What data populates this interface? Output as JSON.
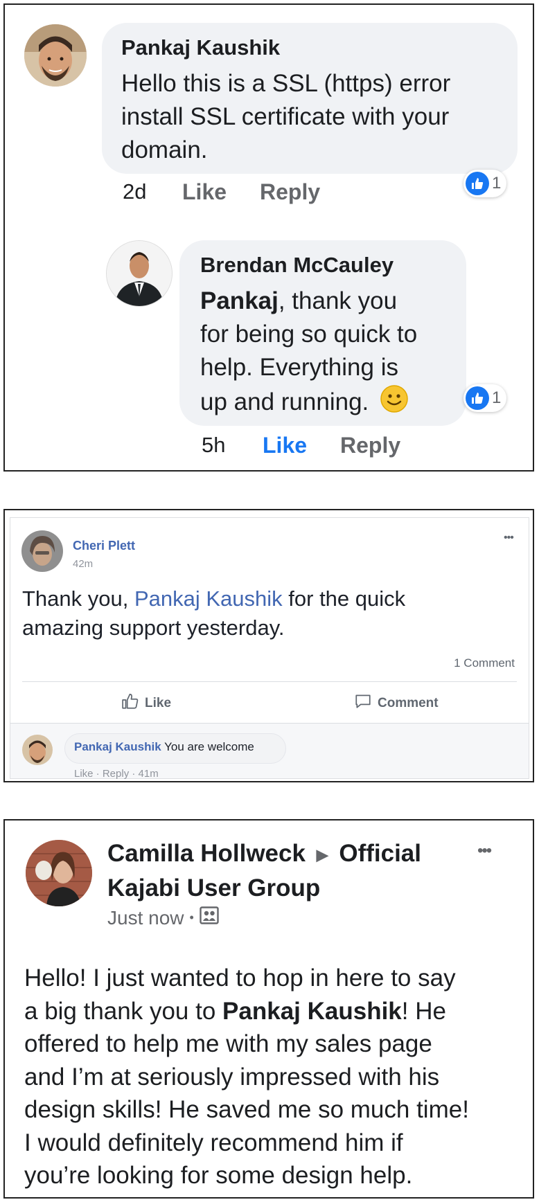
{
  "card1": {
    "comment": {
      "author": "Pankaj Kaushik",
      "lines": [
        "Hello this is a SSL (https) error",
        "install SSL certificate with your",
        "domain."
      ],
      "time": "2d",
      "like_label": "Like",
      "reply_label": "Reply",
      "reaction_count": "1"
    },
    "reply": {
      "author": "Brendan McCauley",
      "mention": "Pankaj",
      "line1_rest": ", thank you",
      "lines": [
        "for being so quick to",
        "help. Everything is",
        "up and running."
      ],
      "emoji": "🙂",
      "time": "5h",
      "like_label": "Like",
      "reply_label": "Reply",
      "reaction_count": "1",
      "like_active_color": "#1877f2"
    }
  },
  "card2": {
    "author": "Cheri Plett",
    "time": "42m",
    "more": "•••",
    "text_before": "Thank you, ",
    "text_mention": "Pankaj Kaushik",
    "text_after_line1": " for the quick",
    "text_line2": "amazing support yesterday.",
    "comment_count": "1 Comment",
    "like_label": "Like",
    "comment_label": "Comment",
    "reply": {
      "author": "Pankaj Kaushik",
      "text": "You are welcome",
      "meta": "Like · Reply · 41m"
    },
    "link_color": "#4267b2"
  },
  "card3": {
    "author": "Camilla Hollweck",
    "arrow": "▶",
    "group_line1": "Official",
    "group_line2": "Kajabi User Group",
    "time": "Just now",
    "dot": "•",
    "more": "•••",
    "post": {
      "line1": "Hello! I just wanted to hop in here to say",
      "line2_before": "a big thank you to ",
      "line2_bold": "Pankaj Kaushik",
      "line2_after": "! He",
      "line3": "offered to help me with my sales page",
      "line4": "and I’m at seriously impressed with his",
      "line5": "design skills! He saved me so much time!",
      "line6": "I would definitely recommend him if",
      "line7": "you’re looking for some design help."
    }
  }
}
